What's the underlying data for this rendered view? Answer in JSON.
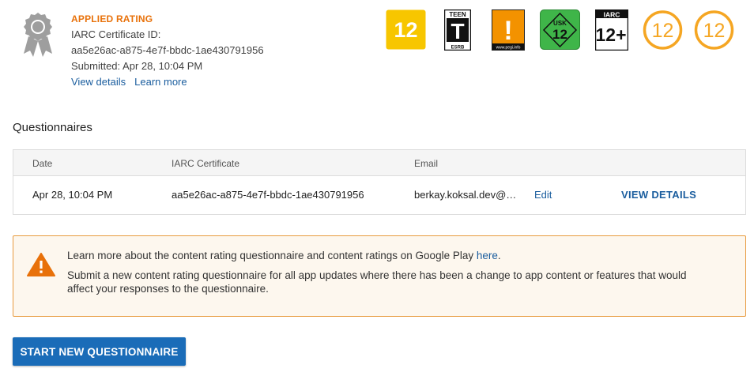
{
  "applied_rating": {
    "title": "APPLIED RATING",
    "certificate_label": "IARC Certificate ID:",
    "certificate_id": "aa5e26ac-a875-4e7f-bbdc-1ae430791956",
    "submitted": "Submitted: Apr 28, 10:04 PM",
    "view_details_link": "View details",
    "learn_more_link": "Learn more",
    "icon": "award-ribbon-icon"
  },
  "badges": [
    {
      "name": "rating-badge-12-yellow",
      "text": "12",
      "color": "#f7c600"
    },
    {
      "name": "esrb-teen-badge",
      "top_text": "TEEN",
      "main_text": "T",
      "bottom_text": "ESRB"
    },
    {
      "name": "pegi-warning-badge",
      "main_text": "!",
      "bottom_text": "www.pegi.info",
      "color": "#f39200"
    },
    {
      "name": "usk-12-badge",
      "top_text": "USK",
      "main_text": "12",
      "color": "#3fb549"
    },
    {
      "name": "iarc-12plus-badge",
      "top_text": "IARC",
      "main_text": "12+"
    },
    {
      "name": "rating-circle-12-a",
      "text": "12",
      "color": "#f5a623"
    },
    {
      "name": "rating-circle-12-b",
      "text": "12",
      "color": "#f5a623"
    }
  ],
  "questionnaires": {
    "title": "Questionnaires",
    "headers": {
      "date": "Date",
      "certificate": "IARC Certificate",
      "email": "Email"
    },
    "rows": [
      {
        "date": "Apr 28, 10:04 PM",
        "certificate": "aa5e26ac-a875-4e7f-bbdc-1ae430791956",
        "email": "berkay.koksal.dev@g…",
        "edit": "Edit",
        "view_details": "VIEW DETAILS"
      }
    ]
  },
  "warning": {
    "icon": "warning-triangle-icon",
    "line1": "Learn more about the content rating questionnaire and content ratings on Google Play ",
    "line1_link": "here",
    "line1_end": ".",
    "line2": "Submit a new content rating questionnaire for all app updates where there has been a change to app content or features that would affect your responses to the questionnaire.",
    "color": "#e8710a"
  },
  "start_button": {
    "label": "START NEW QUESTIONNAIRE",
    "color": "#1a6cb8"
  }
}
